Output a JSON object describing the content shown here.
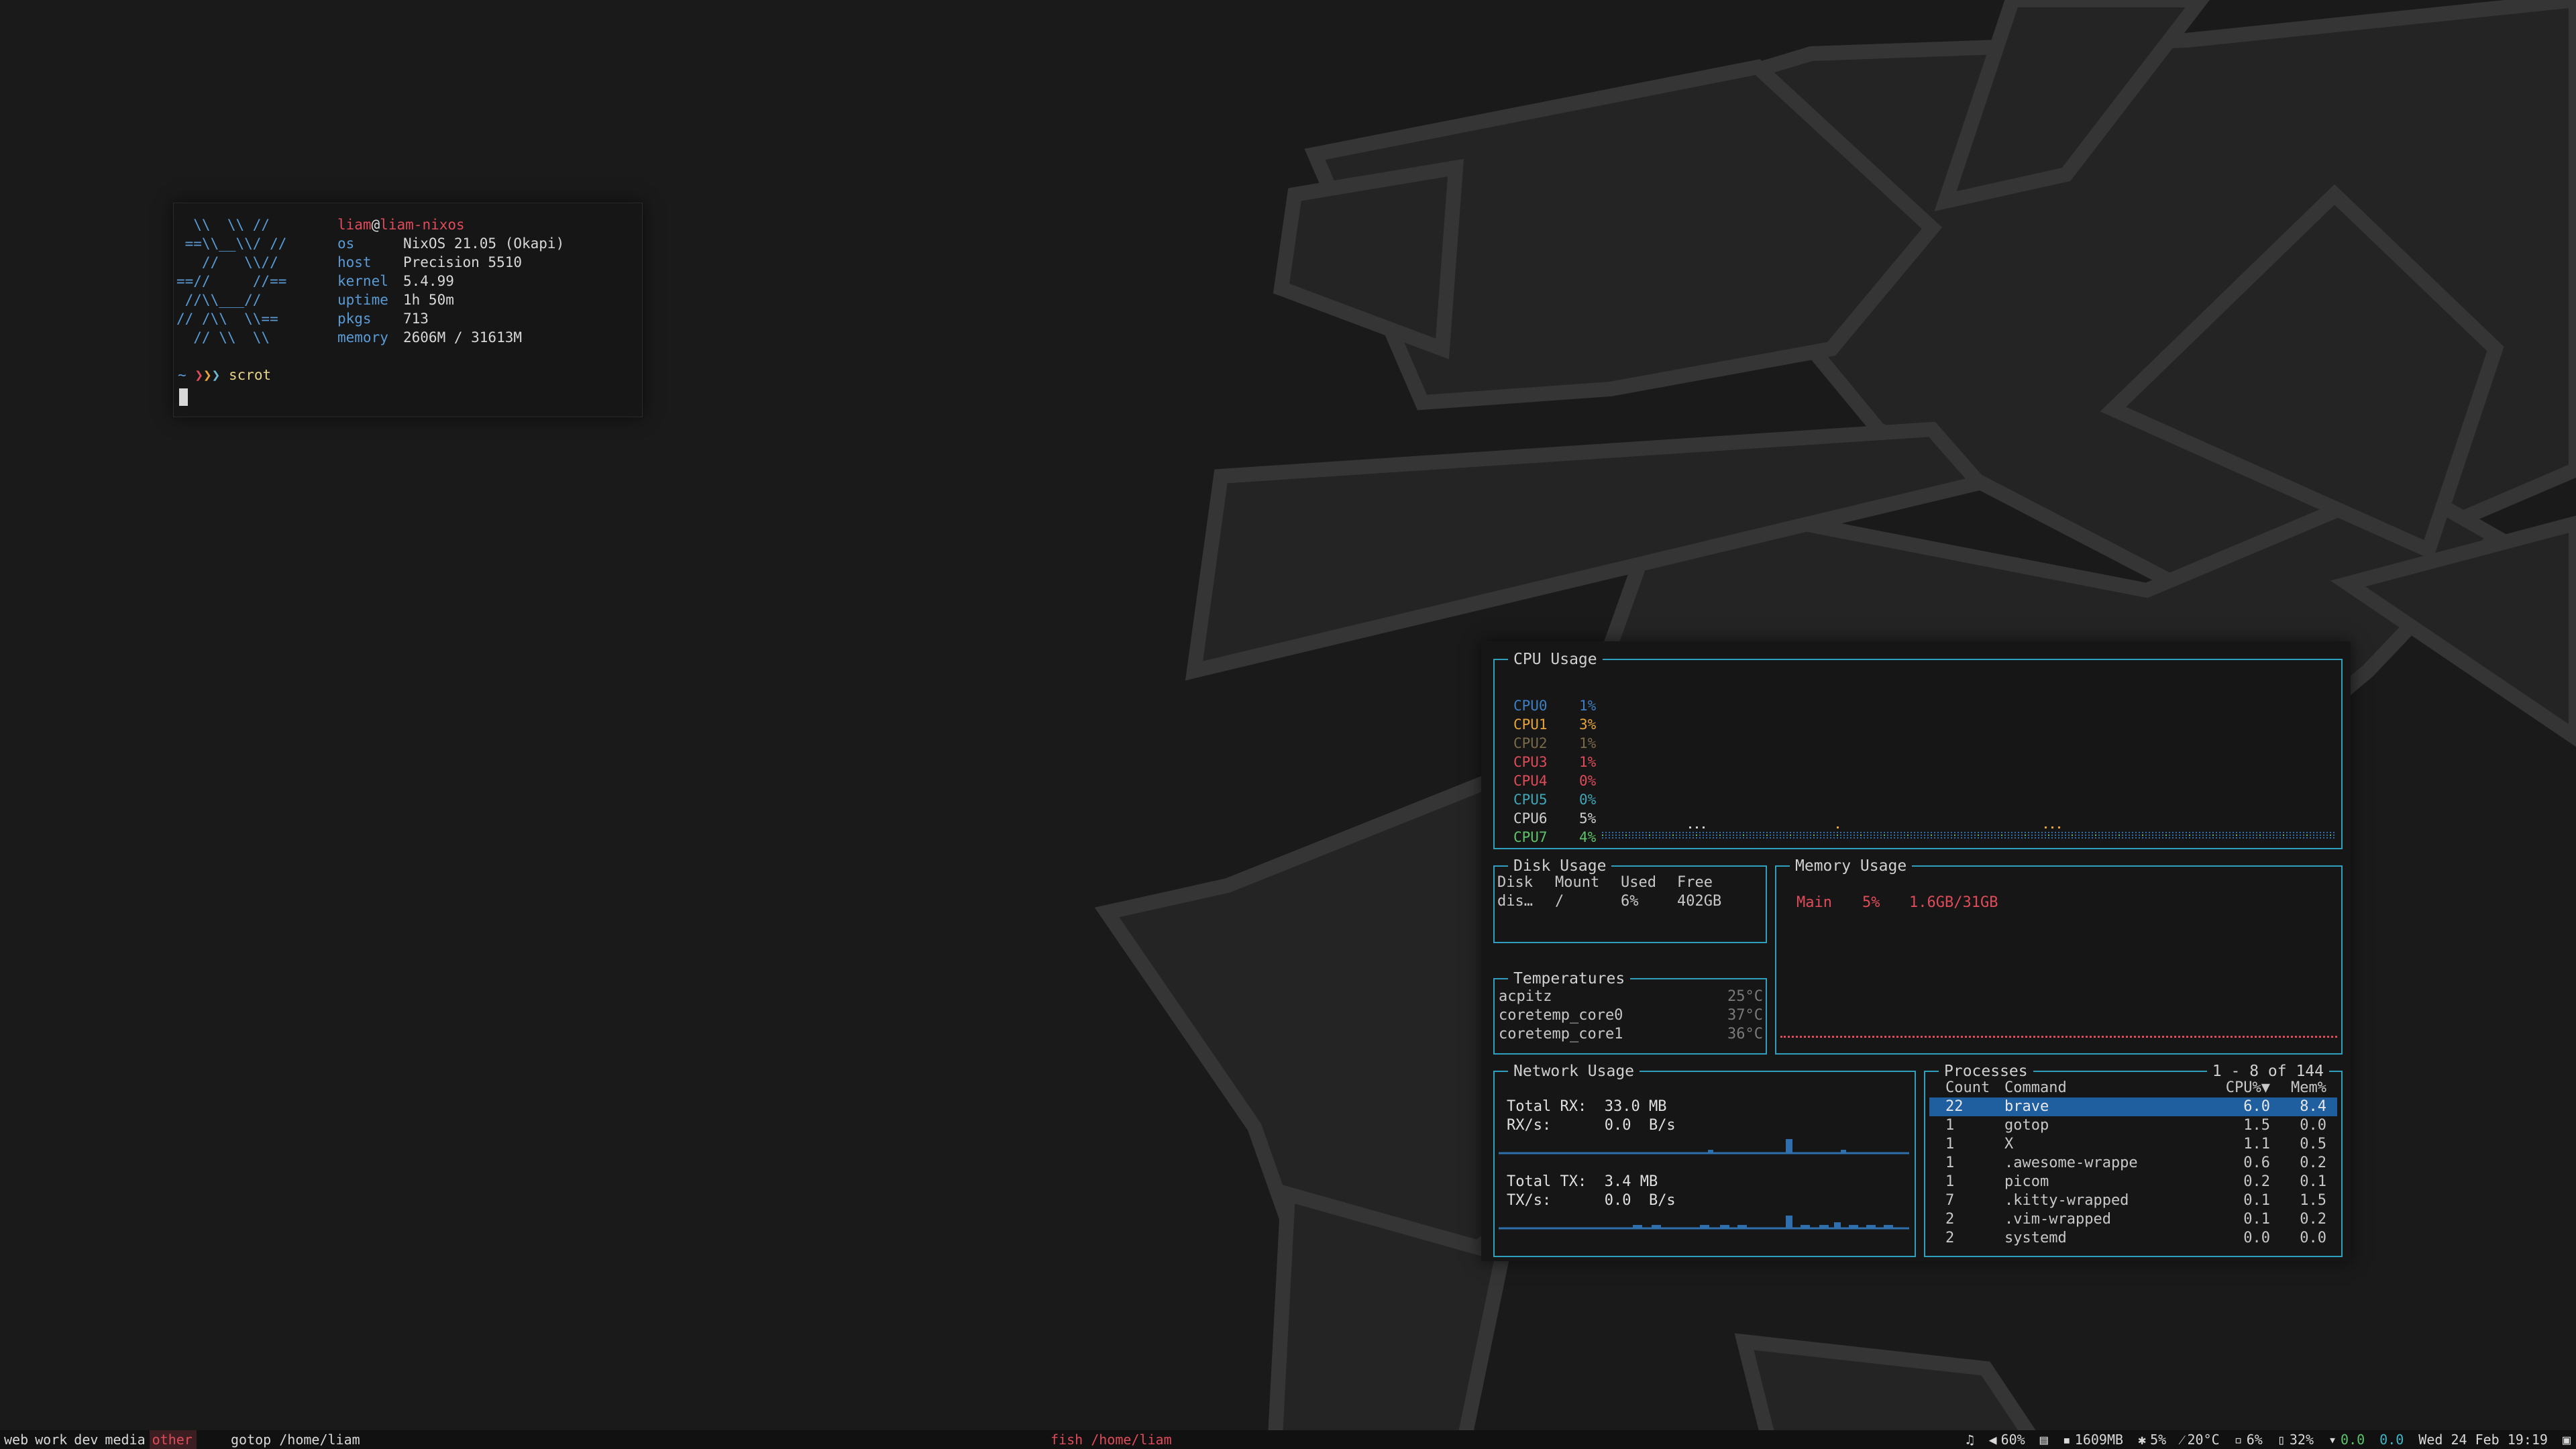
{
  "colors": {
    "accent": "#2f9fbd",
    "red": "#e04b5a",
    "blue": "#5a9bd6",
    "orange": "#e8a33a",
    "green": "#5cc46a",
    "selection": "#1f5fa0"
  },
  "terminal": {
    "logo_lines": [
      "  \\\\  \\\\ //",
      " ==\\\\__\\\\/ //",
      "   //   \\\\//",
      "==//     //==",
      " //\\\\___//",
      "// /\\\\  \\\\==",
      "  // \\\\  \\\\"
    ],
    "user": "liam",
    "at": "@",
    "host": "liam-nixos",
    "info": [
      {
        "key": "os",
        "value": "NixOS 21.05 (Okapi)"
      },
      {
        "key": "host",
        "value": "Precision 5510"
      },
      {
        "key": "kernel",
        "value": "5.4.99"
      },
      {
        "key": "uptime",
        "value": "1h 50m"
      },
      {
        "key": "pkgs",
        "value": "713"
      },
      {
        "key": "memory",
        "value": "2606M / 31613M"
      }
    ],
    "prompt_dir": "~",
    "prompt_arrows": [
      "❯",
      "❯",
      "❯"
    ],
    "command": "scrot"
  },
  "gotop": {
    "cpu": {
      "title": "CPU Usage",
      "cores": [
        {
          "name": "CPU0",
          "value": "1%",
          "color": "#3c7fc4"
        },
        {
          "name": "CPU1",
          "value": "3%",
          "color": "#e8a33a"
        },
        {
          "name": "CPU2",
          "value": "1%",
          "color": "#7a6a4a"
        },
        {
          "name": "CPU3",
          "value": "1%",
          "color": "#e04b5a"
        },
        {
          "name": "CPU4",
          "value": "0%",
          "color": "#e04b5a"
        },
        {
          "name": "CPU5",
          "value": "0%",
          "color": "#3fa7b8"
        },
        {
          "name": "CPU6",
          "value": "5%",
          "color": "#d0d0d0"
        },
        {
          "name": "CPU7",
          "value": "4%",
          "color": "#5cc46a"
        }
      ]
    },
    "disk": {
      "title": "Disk Usage",
      "headers": [
        "Disk",
        "Mount",
        "Used",
        "Free"
      ],
      "rows": [
        [
          "dis…",
          "/",
          "6%",
          "402GB"
        ]
      ]
    },
    "memory": {
      "title": "Memory Usage",
      "label": "Main",
      "percent": "5%",
      "used": "1.6GB/31GB"
    },
    "temps": {
      "title": "Temperatures",
      "rows": [
        {
          "name": "acpitz",
          "value": "25°C"
        },
        {
          "name": "coretemp_core0",
          "value": "37°C"
        },
        {
          "name": "coretemp_core1",
          "value": "36°C"
        }
      ]
    },
    "network": {
      "title": "Network Usage",
      "rx_total_label": "Total RX:",
      "rx_total": "33.0 MB",
      "rx_rate_label": "RX/s:",
      "rx_rate": "0.0  B/s",
      "tx_total_label": "Total TX:",
      "tx_total": "3.4 MB",
      "tx_rate_label": "TX/s:",
      "tx_rate": "0.0  B/s"
    },
    "processes": {
      "title": "Processes",
      "range": "1 - 8 of 144",
      "headers": [
        "Count",
        "Command",
        "CPU%▼",
        "Mem%"
      ],
      "rows": [
        [
          "22",
          "brave",
          "6.0",
          "8.4"
        ],
        [
          "1",
          "gotop",
          "1.5",
          "0.0"
        ],
        [
          "1",
          "X",
          "1.1",
          "0.5"
        ],
        [
          "1",
          ".awesome-wrappe",
          "0.6",
          "0.2"
        ],
        [
          "1",
          "picom",
          "0.2",
          "0.1"
        ],
        [
          "7",
          ".kitty-wrapped",
          "0.1",
          "1.5"
        ],
        [
          "2",
          ".vim-wrapped",
          "0.1",
          "0.2"
        ],
        [
          "2",
          "systemd",
          "0.0",
          "0.0"
        ]
      ]
    }
  },
  "statusbar": {
    "tags": [
      "web",
      "work",
      "dev",
      "media",
      "other"
    ],
    "active_tag": "other",
    "window_title": "gotop /home/liam",
    "center_title": "fish /home/liam",
    "right": [
      {
        "icon": "music-icon",
        "glyph": "♫",
        "text": ""
      },
      {
        "icon": "volume-icon",
        "glyph": "◀",
        "text": "60%"
      },
      {
        "icon": "memory-icon",
        "glyph": "▤",
        "text": ""
      },
      {
        "icon": "ram-icon",
        "glyph": "▪",
        "text": "1609MB"
      },
      {
        "icon": "cpu-icon",
        "glyph": "✱",
        "text": "5%"
      },
      {
        "icon": "temp-icon",
        "glyph": "⁄",
        "text": "20°C"
      },
      {
        "icon": "disk-icon",
        "glyph": "▫",
        "text": "6%"
      },
      {
        "icon": "battery-icon",
        "glyph": "▯",
        "text": "32%"
      },
      {
        "icon": "wifi-icon",
        "glyph": "▾",
        "text": "0.0"
      },
      {
        "icon": "net-icon",
        "glyph": "",
        "text": "0.0"
      },
      {
        "icon": "clock-icon",
        "glyph": "",
        "text": "Wed 24 Feb 19:19"
      },
      {
        "icon": "layout-icon",
        "glyph": "▣",
        "text": ""
      }
    ]
  }
}
